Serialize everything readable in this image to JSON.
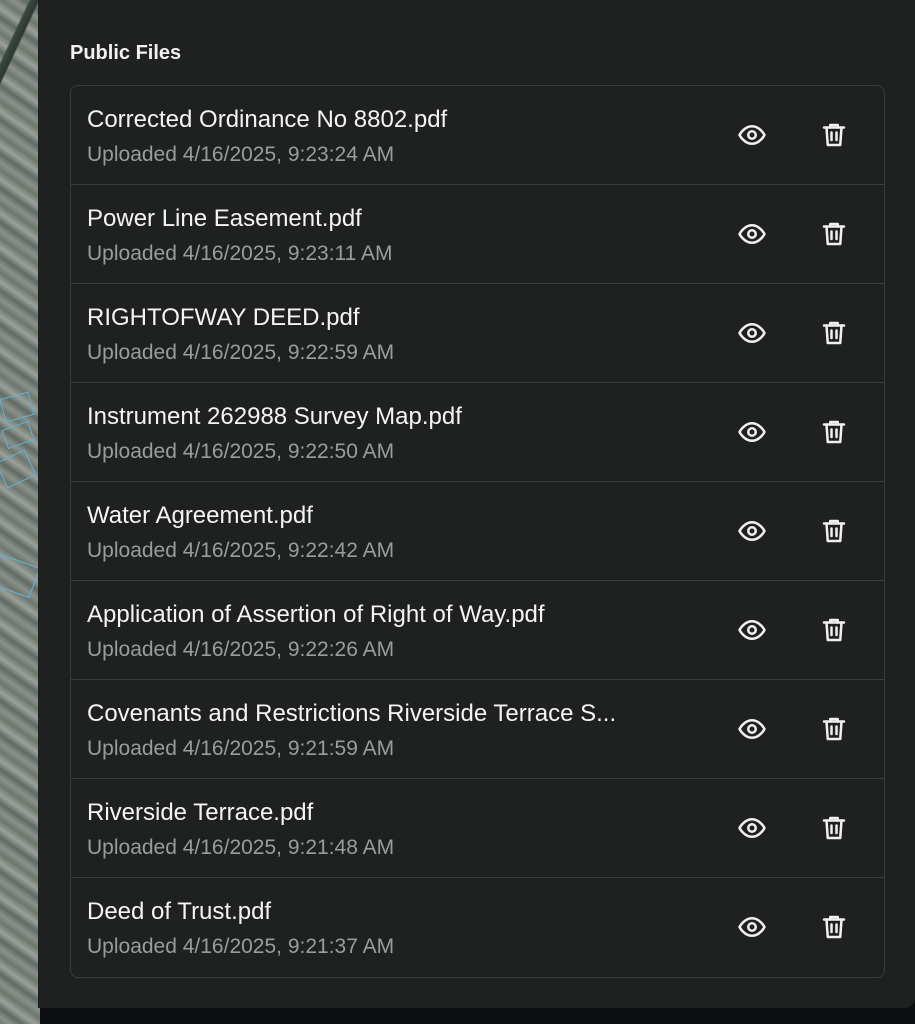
{
  "panel": {
    "title": "Public Files"
  },
  "icons": {
    "view": "eye-icon",
    "delete": "trash-icon"
  },
  "files": [
    {
      "name": "Corrected Ordinance No 8802.pdf",
      "uploaded": "Uploaded 4/16/2025, 9:23:24 AM"
    },
    {
      "name": "Power Line Easement.pdf",
      "uploaded": "Uploaded 4/16/2025, 9:23:11 AM"
    },
    {
      "name": "RIGHTOFWAY DEED.pdf",
      "uploaded": "Uploaded 4/16/2025, 9:22:59 AM"
    },
    {
      "name": "Instrument 262988 Survey Map.pdf",
      "uploaded": "Uploaded 4/16/2025, 9:22:50 AM"
    },
    {
      "name": "Water Agreement.pdf",
      "uploaded": "Uploaded 4/16/2025, 9:22:42 AM"
    },
    {
      "name": "Application of Assertion of Right of Way.pdf",
      "uploaded": "Uploaded 4/16/2025, 9:22:26 AM"
    },
    {
      "name": "Covenants and Restrictions Riverside Terrace S...",
      "uploaded": "Uploaded 4/16/2025, 9:21:59 AM"
    },
    {
      "name": "Riverside Terrace.pdf",
      "uploaded": "Uploaded 4/16/2025, 9:21:48 AM"
    },
    {
      "name": "Deed of Trust.pdf",
      "uploaded": "Uploaded 4/16/2025, 9:21:37 AM"
    }
  ]
}
